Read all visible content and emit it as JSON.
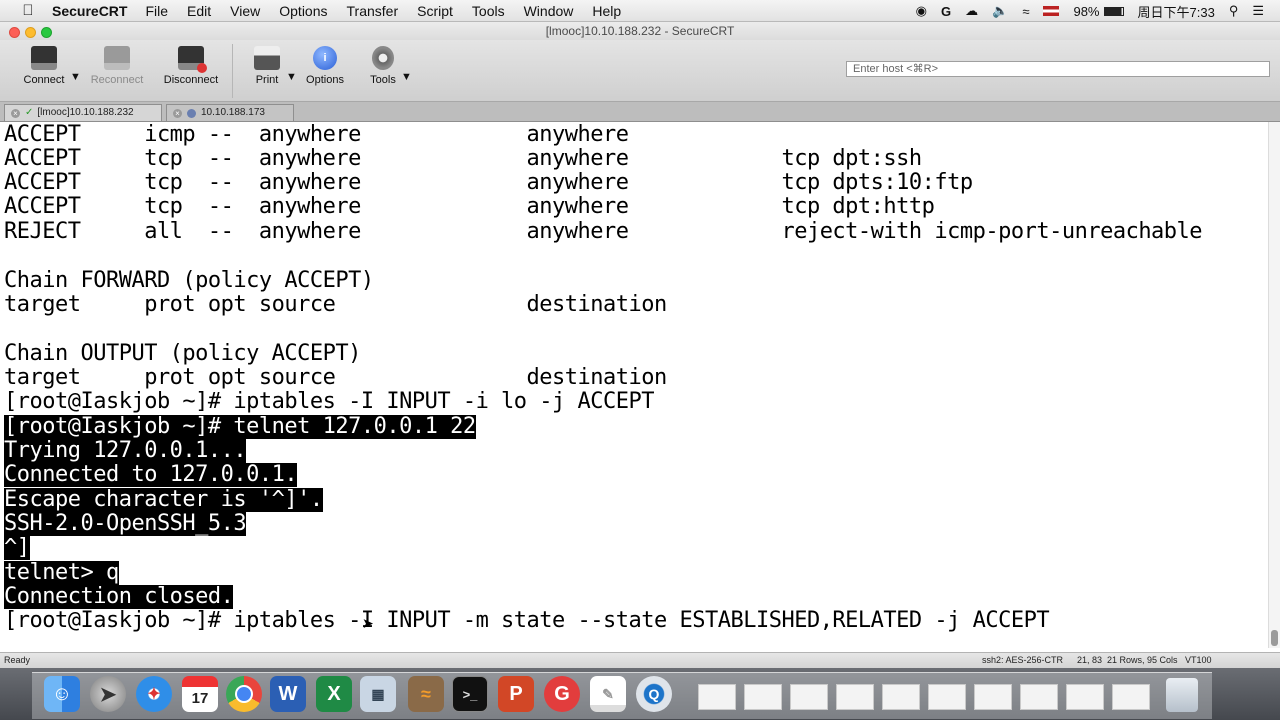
{
  "menubar": {
    "app_name": "SecureCRT",
    "items": [
      "File",
      "Edit",
      "View",
      "Options",
      "Transfer",
      "Script",
      "Tools",
      "Window",
      "Help"
    ],
    "battery": "98%",
    "clock": "周日下午7:33"
  },
  "window": {
    "title": "[lmooc]10.10.188.232 - SecureCRT"
  },
  "toolbar": {
    "connect": "Connect",
    "reconnect": "Reconnect",
    "disconnect": "Disconnect",
    "print": "Print",
    "options": "Options",
    "tools": "Tools",
    "host_placeholder": "Enter host <⌘R>"
  },
  "tabs": [
    {
      "label": "[lmooc]10.10.188.232"
    },
    {
      "label": "10.10.188.173"
    }
  ],
  "terminal": {
    "lines": [
      "ACCEPT     icmp --  anywhere             anywhere",
      "ACCEPT     tcp  --  anywhere             anywhere            tcp dpt:ssh",
      "ACCEPT     tcp  --  anywhere             anywhere            tcp dpts:10:ftp",
      "ACCEPT     tcp  --  anywhere             anywhere            tcp dpt:http",
      "REJECT     all  --  anywhere             anywhere            reject-with icmp-port-unreachable",
      "",
      "Chain FORWARD (policy ACCEPT)",
      "target     prot opt source               destination",
      "",
      "Chain OUTPUT (policy ACCEPT)",
      "target     prot opt source               destination",
      "[root@Iaskjob ~]# iptables -I INPUT -i lo -j ACCEPT",
      "[root@Iaskjob ~]# telnet 127.0.0.1 22",
      "Trying 127.0.0.1...",
      "Connected to 127.0.0.1.",
      "Escape character is '^]'.",
      "SSH-2.0-OpenSSH_5.3",
      "^]",
      "telnet> q",
      "Connection closed.",
      "[root@Iaskjob ~]# iptables -I INPUT -m state --state ESTABLISHED,RELATED -j ACCEPT"
    ]
  },
  "status": {
    "left": "Ready",
    "cipher": "ssh2: AES-256-CTR",
    "position": "21, 83",
    "rows": "21 Rows, 95 Cols",
    "term": "VT100"
  },
  "colors": {
    "terminal_bg": "#ffffff",
    "terminal_fg": "#000000",
    "highlight_bg": "#000000",
    "highlight_fg": "#ffffff"
  }
}
